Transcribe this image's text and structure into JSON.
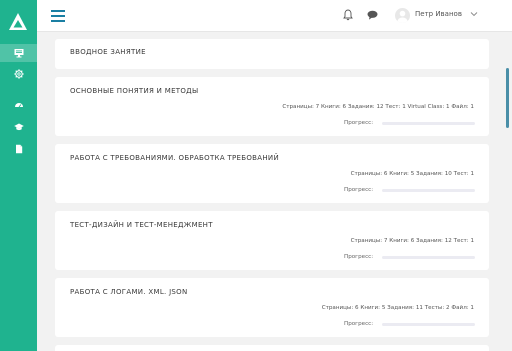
{
  "header": {
    "user_name": "Петр Иванов"
  },
  "sidebar": {
    "items": [
      {
        "icon": "monitor-icon"
      },
      {
        "icon": "gear-icon"
      },
      {
        "icon": "dashboard-icon"
      },
      {
        "icon": "graduation-cap-icon"
      },
      {
        "icon": "document-icon"
      }
    ]
  },
  "colors": {
    "sidebar": "#1fb38f",
    "accent": "#1a7fa3"
  },
  "modules": [
    {
      "title": "ВВОДНОЕ ЗАНЯТИЕ"
    },
    {
      "title": "ОСНОВНЫЕ ПОНЯТИЯ И МЕТОДЫ",
      "stats": "Страницы: 7 Книги: 6 Задания: 12 Тест: 1 Virtual Class: 1 Файл: 1",
      "progress_label": "Прогресс:",
      "progress": 0
    },
    {
      "title": "РАБОТА С ТРЕБОВАНИЯМИ. ОБРАБОТКА ТРЕБОВАНИЙ",
      "stats": "Страницы: 6 Книги: 5 Задания: 10 Тест: 1",
      "progress_label": "Прогресс:",
      "progress": 0
    },
    {
      "title": "ТЕСТ-ДИЗАЙН И ТЕСТ-МЕНЕДЖМЕНТ",
      "stats": "Страницы: 7 Книги: 6 Задания: 12 Тест: 1",
      "progress_label": "Прогресс:",
      "progress": 0
    },
    {
      "title": "РАБОТА С ЛОГАМИ. XML. JSON",
      "stats": "Страницы: 6 Книги: 5 Задания: 11 Тесты: 2 Файл: 1",
      "progress_label": "Прогресс:",
      "progress": 0
    }
  ]
}
